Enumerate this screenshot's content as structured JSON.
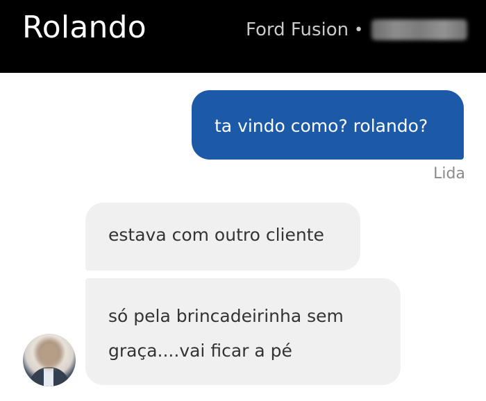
{
  "header": {
    "title": "Rolando",
    "vehicle": "Ford Fusion",
    "separator": "•"
  },
  "messages": {
    "outgoing": {
      "text": "ta vindo como? rolando?",
      "status": "Lida"
    },
    "incoming": [
      {
        "text": "estava com outro cliente"
      },
      {
        "text": "só pela brincadeirinha sem graça....vai ficar a pé"
      }
    ]
  },
  "colors": {
    "header_bg": "#000000",
    "outgoing_bubble": "#1c5aa8",
    "incoming_bubble": "#f0f0f0"
  },
  "icons": {
    "avatar": "driver-avatar"
  }
}
